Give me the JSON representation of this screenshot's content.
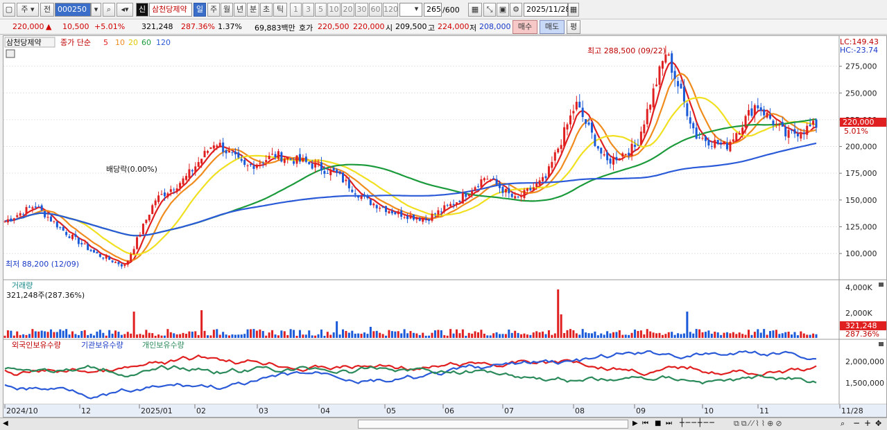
{
  "toolbar": {
    "market": "주",
    "prev_label": "전",
    "code": "000250",
    "new_badge": "신",
    "stock_name": "삼천당제약",
    "periods": [
      "일",
      "주",
      "월",
      "년",
      "분",
      "초",
      "틱"
    ],
    "active_period": "일",
    "intervals": [
      "1",
      "3",
      "5",
      "10",
      "20",
      "30",
      "60",
      "120"
    ],
    "count": "265",
    "count_max": "/600",
    "date": "2025/11/28"
  },
  "quote": {
    "price": "220,000",
    "change": "10,500",
    "change_pct": "+5.01%",
    "volume": "321,248",
    "vol_pct": "287.36%",
    "turnover": "1.37%",
    "amount": "69,883백만",
    "ask_label": "호가",
    "ask": "220,500",
    "bid": "220,000",
    "open_label": "시",
    "open": "209,500",
    "high_label": "고",
    "high": "224,000",
    "low_label": "저",
    "low": "208,000",
    "buy_label": "매수",
    "sell_label": "매도",
    "eval_label": "평"
  },
  "price_panel": {
    "legend_name": "삼천당제약",
    "legend_series_prefix": "종가 단순",
    "ma_periods": [
      "5",
      "10",
      "20",
      "60",
      "120"
    ],
    "ma_colors": [
      "#e02020",
      "#f08c1e",
      "#f0e020",
      "#1a9a3a",
      "#2a5ad8"
    ],
    "lc": "LC:149.43",
    "hc": "HC:-23.74",
    "y_ticks": [
      "275,000",
      "250,000",
      "225,000",
      "200,000",
      "175,000",
      "150,000",
      "125,000",
      "100,000"
    ],
    "current_price": "220,000",
    "current_pct": "5.01%",
    "high_annotation": "최고 288,500 (09/22)",
    "low_annotation": "최저 88,200 (12/09)",
    "dividend_annotation": "배당락(0.00%)"
  },
  "volume_panel": {
    "title": "거래량",
    "value": "321,248주(287.36%)",
    "y_ticks": [
      "4,000K",
      "2,000K"
    ],
    "current": "321,248",
    "current_pct": "287.36%"
  },
  "holding_panel": {
    "series": [
      "외국인보유수량",
      "기관보유수량",
      "개인보유수량"
    ],
    "colors": [
      "#e02020",
      "#2a5ad8",
      "#2a8a5a"
    ],
    "y_ticks": [
      "2,000,000",
      "1,500,000"
    ]
  },
  "x_axis": {
    "labels": [
      "2024/10",
      "12",
      "2025/01",
      "02",
      "03",
      "04",
      "05",
      "06",
      "07",
      "08",
      "09",
      "10",
      "11",
      "11/28"
    ]
  },
  "chart_data": {
    "type": "candlestick",
    "title": "",
    "ylim": [
      80000,
      300000
    ],
    "close_path": [
      [
        "2024/10",
        130000
      ],
      [
        "2024/10",
        145000
      ],
      [
        "2024/11",
        120000
      ],
      [
        "2024/11",
        100000
      ],
      [
        "2024/12",
        88200
      ],
      [
        "2024/12",
        150000
      ],
      [
        "2025/01",
        170000
      ],
      [
        "2025/02",
        205000
      ],
      [
        "2025/02",
        180000
      ],
      [
        "2025/03",
        192000
      ],
      [
        "2025/03",
        185000
      ],
      [
        "2025/04",
        175000
      ],
      [
        "2025/04",
        150000
      ],
      [
        "2025/05",
        138000
      ],
      [
        "2025/05",
        132000
      ],
      [
        "2025/06",
        148000
      ],
      [
        "2025/06",
        172000
      ],
      [
        "2025/07",
        150000
      ],
      [
        "2025/07",
        170000
      ],
      [
        "2025/08",
        240000
      ],
      [
        "2025/08",
        185000
      ],
      [
        "2025/09",
        200000
      ],
      [
        "2025/09",
        288500
      ],
      [
        "2025/10",
        210000
      ],
      [
        "2025/10",
        200000
      ],
      [
        "2025/11",
        240000
      ],
      [
        "2025/11",
        210000
      ],
      [
        "2025/11/28",
        220000
      ]
    ]
  }
}
